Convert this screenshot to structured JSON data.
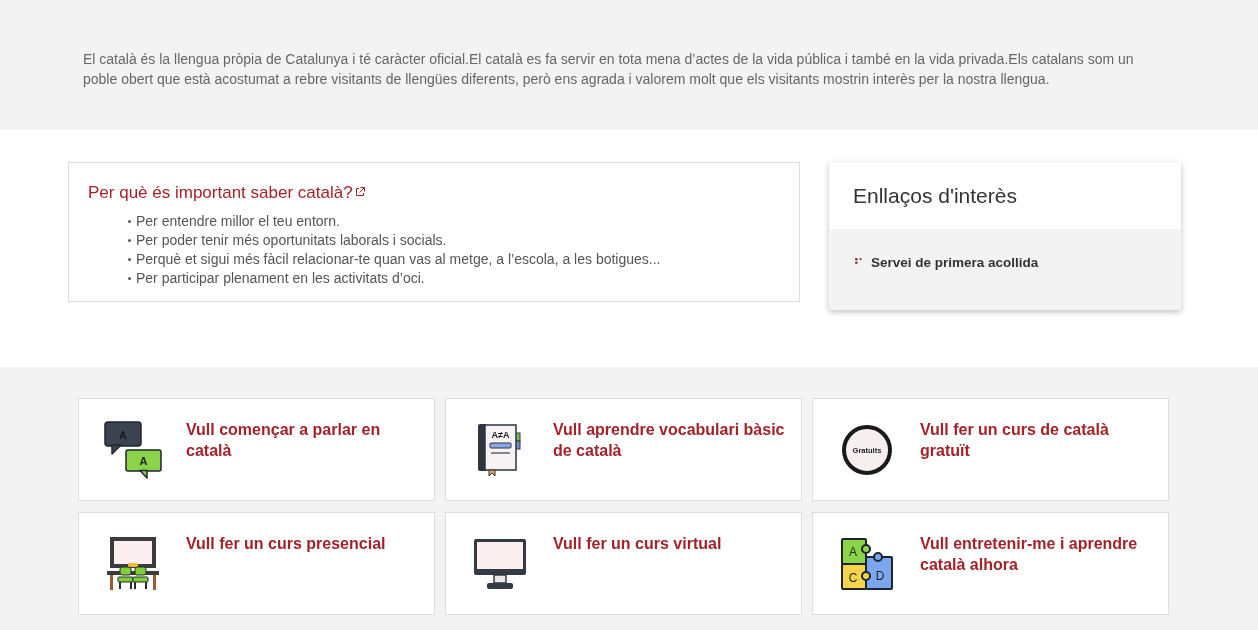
{
  "intro": {
    "text": "El català és la llengua pròpia de Catalunya i té caràcter oficial.El català es fa servir en tota mena d’actes de la vida pública i també en la vida privada.Els catalans som un poble obert que està acostumat a rebre visitants de llengües diferents, però ens agrada i valorem molt que els visitants mostrin interès per la nostra llengua."
  },
  "info_box": {
    "title": "Per què és important saber català?",
    "bullets": [
      "Per entendre millor el teu entorn.",
      "Per poder tenir més oportunitats laborals i socials.",
      "Perquè et sigui més fàcil relacionar-te quan vas al metge, a l’escola, a les botigues...",
      "Per participar plenament en les activitats d’oci."
    ]
  },
  "links_card": {
    "title": "Enllaços d'interès",
    "links": [
      "Servei de primera acollida"
    ]
  },
  "options": [
    {
      "kind": "chat",
      "icon_text": [
        "A",
        "A"
      ],
      "label": "Vull començar a parlar en català"
    },
    {
      "kind": "book",
      "icon_text": [
        "A≠A"
      ],
      "label": "Vull aprendre vocabulari bàsic de català"
    },
    {
      "kind": "badge",
      "icon_text": [
        "Gratuits"
      ],
      "label": "Vull fer un curs de català gratuït"
    },
    {
      "kind": "classroom",
      "label": "Vull fer un curs presencial"
    },
    {
      "kind": "monitor",
      "label": "Vull fer un curs virtual"
    },
    {
      "kind": "puzzle",
      "icon_text": [
        "A",
        "C",
        "D"
      ],
      "label": "Vull entretenir-me i aprendre català alhora"
    }
  ]
}
